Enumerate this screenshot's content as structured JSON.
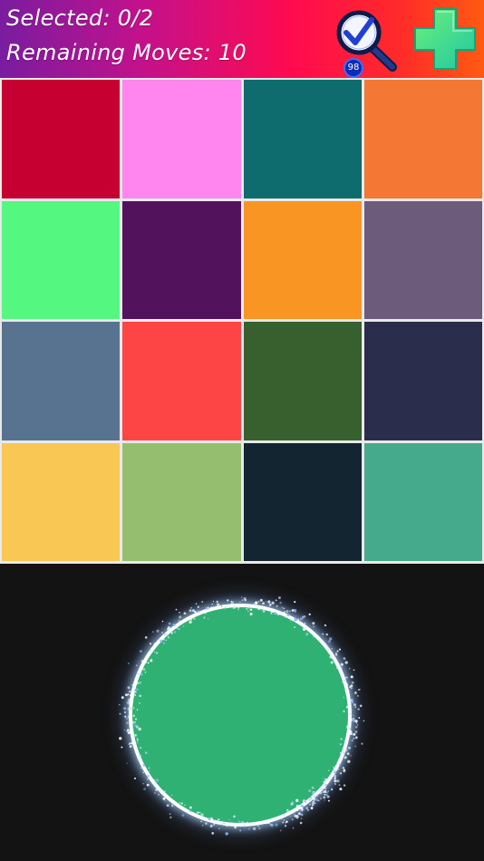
{
  "header": {
    "selected_text": "Selected: 0/2",
    "moves_text": "Remaining Moves: 10",
    "hint_count": "98",
    "gradient_colors": [
      "#7a1ca0",
      "#ff0a50",
      "#ff5a12"
    ]
  },
  "icons": {
    "hint": "magnifier-check-icon",
    "add": "plus-icon"
  },
  "grid": {
    "tiles": [
      {
        "color": "#c70032"
      },
      {
        "color": "#ff86ef"
      },
      {
        "color": "#0e6b6e"
      },
      {
        "color": "#f47733"
      },
      {
        "color": "#54f77f"
      },
      {
        "color": "#52135c"
      },
      {
        "color": "#f99623"
      },
      {
        "color": "#6c5b7b"
      },
      {
        "color": "#58738f"
      },
      {
        "color": "#fe4545"
      },
      {
        "color": "#38602f"
      },
      {
        "color": "#2b2d4c"
      },
      {
        "color": "#f9c753"
      },
      {
        "color": "#95bf6f"
      },
      {
        "color": "#132530"
      },
      {
        "color": "#45aa8b"
      }
    ]
  },
  "target": {
    "color": "#2fb173"
  }
}
